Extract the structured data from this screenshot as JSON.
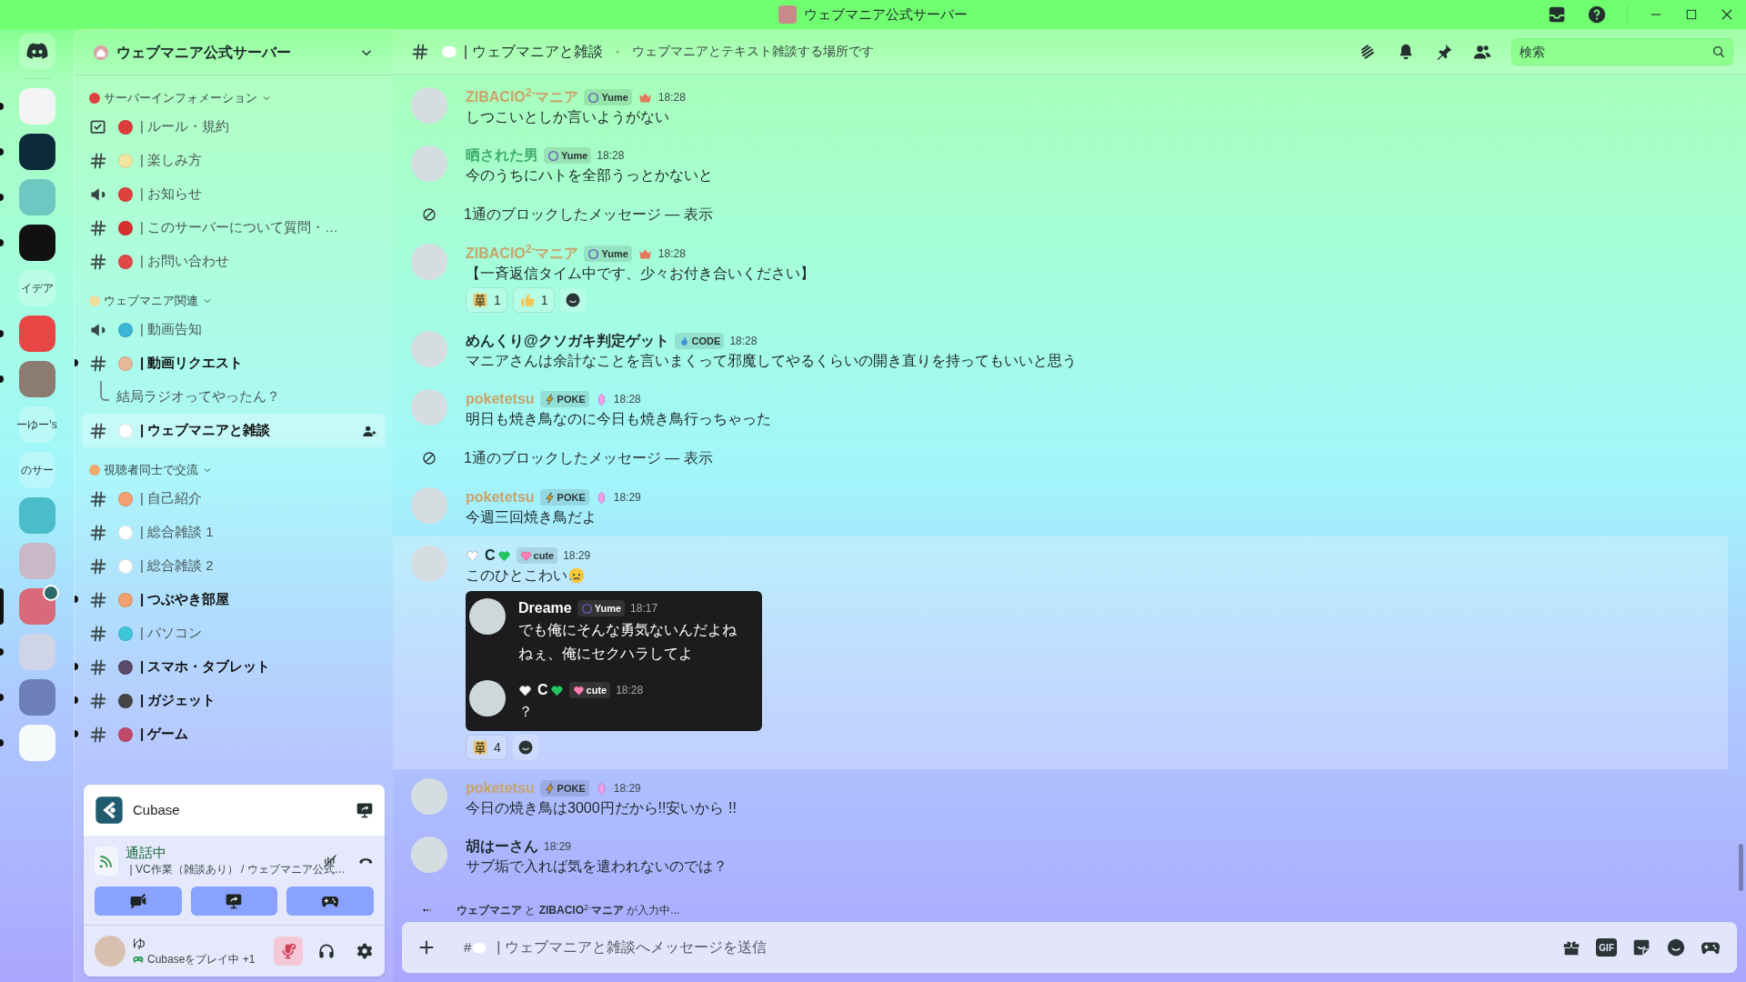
{
  "title_bar": {
    "title": "ウェブマニア公式サーバー"
  },
  "servers": [
    {
      "kind": "home",
      "unread": false,
      "selected": false
    },
    {
      "kind": "image",
      "color": "#f4f4f4",
      "unread": true,
      "selected": false
    },
    {
      "kind": "image",
      "color": "#0d2a3a",
      "unread": true,
      "selected": false
    },
    {
      "kind": "image",
      "color": "#6fc7c2",
      "unread": true,
      "selected": false
    },
    {
      "kind": "image",
      "color": "#111111",
      "unread": true,
      "selected": false
    },
    {
      "kind": "text",
      "label": "イデア",
      "unread": false,
      "selected": false
    },
    {
      "kind": "image",
      "color": "#e84545",
      "unread": true,
      "selected": false
    },
    {
      "kind": "image",
      "color": "#8c7b70",
      "unread": true,
      "selected": false
    },
    {
      "kind": "text",
      "label": "ーゆー's",
      "unread": false,
      "selected": false
    },
    {
      "kind": "text",
      "label": "のサー",
      "unread": false,
      "selected": false
    },
    {
      "kind": "image",
      "color": "#4bbcc9",
      "unread": false,
      "selected": false
    },
    {
      "kind": "image",
      "color": "#c9b8c8",
      "unread": false,
      "selected": false
    },
    {
      "kind": "image",
      "color": "#d96a7a",
      "unread": false,
      "selected": true,
      "voice": true
    },
    {
      "kind": "image",
      "color": "#cfd4e6",
      "unread": true,
      "selected": false
    },
    {
      "kind": "image",
      "color": "#6d7fb8",
      "unread": true,
      "selected": false
    },
    {
      "kind": "image",
      "color": "#f8fbfb",
      "unread": true,
      "selected": false
    }
  ],
  "server_header": {
    "name": "ウェブマニア公式サーバー"
  },
  "categories": [
    {
      "name": "サーバーインフォメーション",
      "color": "#e04040",
      "channels": [
        {
          "kind": "rules",
          "color": "#e03b3b",
          "name": "| ルール・規約",
          "unread": false,
          "selected": false
        },
        {
          "kind": "text",
          "color": "#f3e6a0",
          "name": "| 楽しみ方",
          "unread": false,
          "selected": false
        },
        {
          "kind": "announcement",
          "color": "#e0403d",
          "name": "| お知らせ",
          "unread": false,
          "selected": false
        },
        {
          "kind": "text",
          "color": "#d83030",
          "name": "| このサーバーについて質問・…",
          "unread": false,
          "selected": false
        },
        {
          "kind": "text",
          "color": "#e04848",
          "name": "| お問い合わせ",
          "unread": false,
          "selected": false
        }
      ]
    },
    {
      "name": "ウェブマニア関連",
      "color": "#f1dca0",
      "channels": [
        {
          "kind": "announcement",
          "color": "#3bb6d6",
          "name": "| 動画告知",
          "unread": false,
          "selected": false
        },
        {
          "kind": "text",
          "color": "#e8b89a",
          "name": "| 動画リクエスト",
          "unread": true,
          "selected": false,
          "children": [
            {
              "kind": "thread",
              "name": "結局ラジオってやったん？",
              "unread": false,
              "selected": false
            }
          ]
        },
        {
          "kind": "text",
          "color": "#ffffff",
          "name": "| ウェブマニアと雑談",
          "unread": false,
          "selected": true
        }
      ]
    },
    {
      "name": "視聴者同士で交流",
      "color": "#f0a868",
      "channels": [
        {
          "kind": "text",
          "color": "#f4a070",
          "name": "| 自己紹介",
          "unread": false,
          "selected": false
        },
        {
          "kind": "text",
          "color": "#ffffff",
          "name": "| 総合雑談 1",
          "unread": false,
          "selected": false
        },
        {
          "kind": "text",
          "color": "#ffffff",
          "name": "| 総合雑談 2",
          "unread": false,
          "selected": false
        },
        {
          "kind": "text",
          "color": "#f2a070",
          "name": "| つぶやき部屋",
          "unread": true,
          "selected": false
        },
        {
          "kind": "text",
          "color": "#3fc6d8",
          "name": "| パソコン",
          "unread": false,
          "selected": false
        },
        {
          "kind": "text",
          "color": "#5a4a6a",
          "name": "| スマホ・タブレット",
          "unread": true,
          "selected": false
        },
        {
          "kind": "text",
          "color": "#444444",
          "name": "| ガジェット",
          "unread": true,
          "selected": false
        },
        {
          "kind": "text",
          "color": "#c04a6a",
          "name": "| ゲーム",
          "unread": true,
          "selected": false
        }
      ]
    }
  ],
  "activity": {
    "name": "Cubase"
  },
  "voice": {
    "status": "通話中",
    "channel": "| VC作業（雑談あり） / ウェブマニア公式…"
  },
  "user": {
    "name": "ゆ",
    "activity": "Cubaseをプレイ中 +1",
    "mic_muted": true
  },
  "channel_header": {
    "name": "| ウェブマニアと雑談",
    "topic": "ウェブマニアとテキスト雑談する場所です",
    "search_placeholder": "検索"
  },
  "messages": [
    {
      "kind": "message",
      "author": "ZIBAClO$^{2-}$マニア",
      "color": "#c9a36b",
      "badge": {
        "kind": "moon",
        "label": "Yume"
      },
      "extra_badge": {
        "kind": "crown"
      },
      "time": "18:28",
      "text": "しつこいとしか言いようがない"
    },
    {
      "kind": "message",
      "author": "晒された男",
      "color": "#3fae6a",
      "badge": {
        "kind": "moon",
        "label": "Yume"
      },
      "time": "18:28",
      "text": "今のうちにハトを全部うっとかないと"
    },
    {
      "kind": "blocked",
      "text": "1通のブロックしたメッセージ — 表示"
    },
    {
      "kind": "message",
      "author": "ZIBAClO$^{2-}$マニア",
      "color": "#c9a36b",
      "badge": {
        "kind": "moon",
        "label": "Yume"
      },
      "extra_badge": {
        "kind": "crown"
      },
      "time": "18:28",
      "text": "【一斉返信タイム中です、少々お付き合いください】",
      "reactions": [
        {
          "kind": "kusa",
          "count": "1"
        },
        {
          "kind": "thumbs",
          "count": "1"
        }
      ]
    },
    {
      "kind": "message",
      "author": "めんくり@クソガキ判定ゲット",
      "color": "#1d2b2b",
      "badge": {
        "kind": "flame",
        "label": "CODE"
      },
      "time": "18:28",
      "text": "マニアさんは余計なことを言いまくって邪魔してやるくらいの開き直りを持ってもいいと思う"
    },
    {
      "kind": "message",
      "author": "poketetsu",
      "color": "#c9a36b",
      "badge": {
        "kind": "bolt",
        "label": "POKE"
      },
      "extra_badge": {
        "kind": "crystal"
      },
      "time": "18:28",
      "text": "明日も焼き鳥なのに今日も焼き鳥行っちゃった"
    },
    {
      "kind": "blocked",
      "text": "1通のブロックしたメッセージ — 表示"
    },
    {
      "kind": "message",
      "author": "poketetsu",
      "color": "#c9a36b",
      "badge": {
        "kind": "bolt",
        "label": "POKE"
      },
      "extra_badge": {
        "kind": "crystal"
      },
      "time": "18:29",
      "text": "今週三回焼き鳥だよ"
    },
    {
      "kind": "message",
      "author": "C",
      "author_hearts": true,
      "color": "#1d2b2b",
      "badge": {
        "kind": "heart",
        "label": "cute"
      },
      "time": "18:29",
      "text": "このひとこわい",
      "text_emoji": {
        "kind": "worried"
      },
      "highlighted": true,
      "forward": [
        {
          "author": "Dreame",
          "color": "#ffffff",
          "badge": {
            "kind": "moon",
            "label": "Yume"
          },
          "time": "18:17",
          "lines": [
            "でも俺にそんな勇気ないんだよね",
            "ねぇ、俺にセクハラしてよ"
          ]
        },
        {
          "author": "C",
          "author_hearts": true,
          "color": "#ffffff",
          "badge": {
            "kind": "heart",
            "label": "cute"
          },
          "time": "18:28",
          "lines": [
            "？"
          ]
        }
      ],
      "reactions": [
        {
          "kind": "kusa",
          "count": "4"
        }
      ]
    },
    {
      "kind": "message",
      "author": "poketetsu",
      "color": "#c9a36b",
      "badge": {
        "kind": "bolt",
        "label": "POKE"
      },
      "extra_badge": {
        "kind": "crystal"
      },
      "time": "18:29",
      "text": "今日の焼き鳥は3000円だから!!安いから !!"
    },
    {
      "kind": "message",
      "author": "胡はーさん",
      "color": "#1d2b2b",
      "time": "18:29",
      "text": "サブ垢で入れば気を遣われないのでは？"
    }
  ],
  "typing": "**ウェブマニア** と **ZIBAClO**$^{2-}$**マニア** が入力中...",
  "composer": {
    "hash": "#",
    "placeholder": "| ウェブマニアと雑談へメッセージを送信",
    "gif_label": "GIF"
  }
}
